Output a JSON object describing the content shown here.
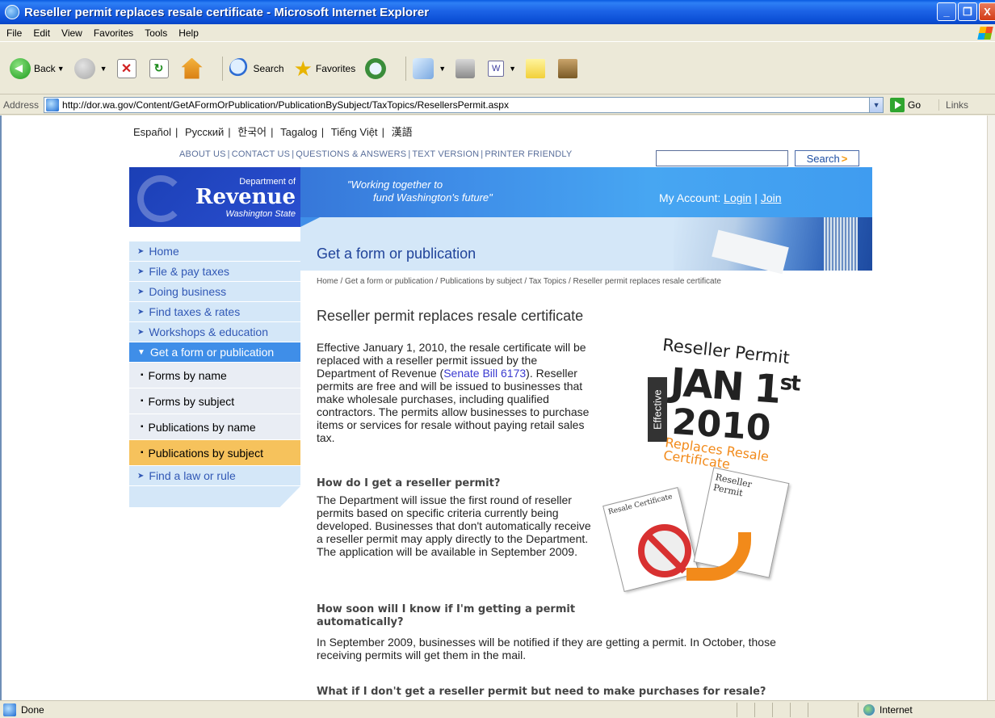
{
  "window": {
    "title": "Reseller permit replaces resale certificate - Microsoft Internet Explorer",
    "buttons": [
      "_",
      "❐",
      "X"
    ]
  },
  "menu": [
    "File",
    "Edit",
    "View",
    "Favorites",
    "Tools",
    "Help"
  ],
  "toolbar": {
    "back": "Back",
    "search": "Search",
    "favorites": "Favorites"
  },
  "address": {
    "label": "Address",
    "url": "http://dor.wa.gov/Content/GetAFormOrPublication/PublicationBySubject/TaxTopics/ResellersPermit.aspx",
    "go": "Go",
    "links": "Links"
  },
  "site": {
    "languages": [
      "Español",
      "Русский",
      "한국어",
      "Tagalog",
      "Tiếng Việt",
      "漢語"
    ],
    "topnav": [
      "ABOUT US",
      "CONTACT US",
      "QUESTIONS & ANSWERS",
      "TEXT VERSION",
      "PRINTER FRIENDLY"
    ],
    "search_button": "Search",
    "logo": {
      "dept": "Department of",
      "name": "Revenue",
      "state": "Washington State"
    },
    "tagline": {
      "line1": "\"Working together to",
      "line2": "fund Washington's future\""
    },
    "account": {
      "label": "My Account:",
      "login": "Login",
      "join": "Join"
    },
    "section_title": "Get a form or publication"
  },
  "sidebar": {
    "items": [
      {
        "label": "Home"
      },
      {
        "label": "File & pay taxes"
      },
      {
        "label": "Doing business"
      },
      {
        "label": "Find taxes & rates"
      },
      {
        "label": "Workshops & education"
      },
      {
        "label": "Get a form or publication"
      }
    ],
    "subitems": [
      {
        "label": "Forms by name"
      },
      {
        "label": "Forms by subject"
      },
      {
        "label": "Publications by name"
      },
      {
        "label": "Publications by subject"
      }
    ],
    "last": "Find a law or rule"
  },
  "content": {
    "breadcrumb": "Home / Get a form or publication / Publications by subject / Tax Topics / Reseller permit replaces resale certificate",
    "heading": "Reseller permit replaces resale certificate",
    "intro_before": "Effective January 1, 2010, the resale certificate will be replaced with a reseller permit issued by the Department of Revenue (",
    "intro_link": "Senate Bill 6173",
    "intro_after": "). Reseller permits are free and will be issued to businesses that make wholesale purchases, including qualified contractors. The permits allow businesses to purchase items or services for resale without paying retail sales tax.",
    "q1": "How do I get a reseller permit?",
    "a1": "The Department will issue the first round of reseller permits based on specific criteria currently being developed. Businesses that don't automatically receive a reseller permit may apply directly to the Department. The application will be available in September 2009.",
    "q2": "How soon will I know if I'm getting a permit automatically?",
    "a2": "In September 2009, businesses will be notified if they are getting a permit. In October, those receiving permits will get them in the mail.",
    "q3": "What if I don't get a reseller permit but need to make purchases for resale?"
  },
  "graphic": {
    "title": "Reseller Permit",
    "effective": "Effective",
    "jan": "JAN 1",
    "jan_sup": "st",
    "year": "2010",
    "replaces1": "Replaces Resale",
    "replaces2": "Certificate",
    "doc_a": "Resale Certificate",
    "doc_b": "Reseller Permit"
  },
  "status": {
    "text": "Done",
    "zone": "Internet"
  }
}
